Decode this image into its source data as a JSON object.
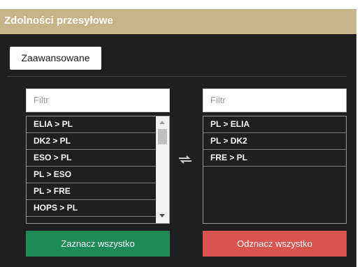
{
  "window": {
    "title": "Zdolności przesyłowe"
  },
  "tabs": [
    {
      "label": "Zaawansowane"
    }
  ],
  "left_panel": {
    "filter_placeholder": "Filtr",
    "items": [
      "ELIA > PL",
      "DK2 > PL",
      "ESO > PL",
      "PL > ESO",
      "PL > FRE",
      "HOPS > PL"
    ],
    "button_label": "Zaznacz wszystko",
    "button_color": "#1e8a55"
  },
  "right_panel": {
    "filter_placeholder": "Filtr",
    "items": [
      "PL > ELIA",
      "PL > DK2",
      "FRE > PL"
    ],
    "button_label": "Odznacz wszystko",
    "button_color": "#d9534f"
  },
  "icons": {
    "swap": "swap-arrows-icon"
  },
  "colors": {
    "title_bar": "#c8b48a",
    "background": "#1f1f1f"
  }
}
